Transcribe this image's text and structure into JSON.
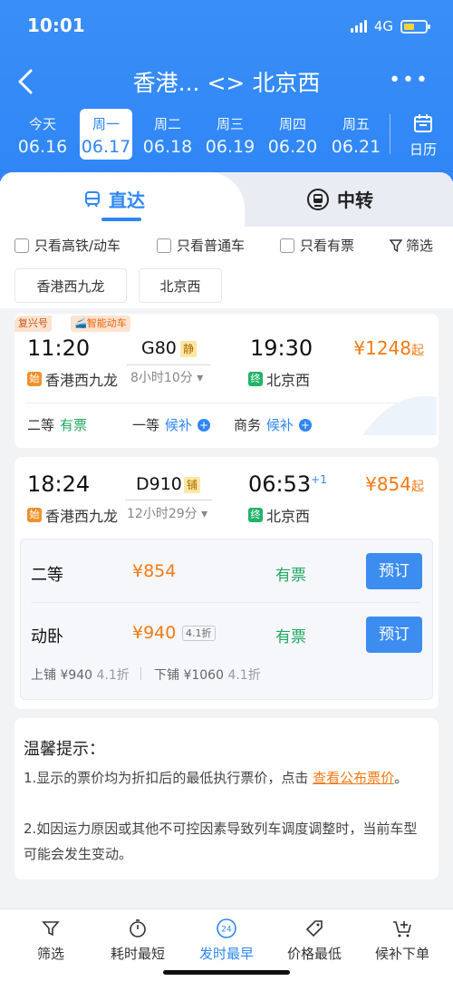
{
  "status_bar": {
    "time": "10:01",
    "network": "4G",
    "battery_level": 0.5
  },
  "header": {
    "route_from": "香港...",
    "route_sep": "<>",
    "route_to": "北京西",
    "more_label": "•••"
  },
  "dates": [
    {
      "dow": "今天",
      "md": "06.16"
    },
    {
      "dow": "周一",
      "md": "06.17",
      "active": true
    },
    {
      "dow": "周二",
      "md": "06.18"
    },
    {
      "dow": "周三",
      "md": "06.19"
    },
    {
      "dow": "周四",
      "md": "06.20"
    },
    {
      "dow": "周五",
      "md": "06.21"
    }
  ],
  "calendar_label": "日历",
  "tabs": {
    "direct": "直达",
    "transfer": "中转"
  },
  "filters": {
    "high_speed": "只看高铁/动车",
    "normal": "只看普通车",
    "available": "只看有票",
    "filter": "筛选"
  },
  "chips": {
    "from": "香港西九龙",
    "to": "北京西"
  },
  "trains": [
    {
      "tags": [
        "复兴号",
        "智能动车"
      ],
      "depart": "11:20",
      "train_no": "G80",
      "badge": "静",
      "duration": "8小时10分",
      "arrive": "19:30",
      "price": "¥1248",
      "price_suffix": "起",
      "from_mark": "始",
      "from_station": "香港西九龙",
      "to_mark": "终",
      "to_station": "北京西",
      "seats": [
        {
          "name": "二等",
          "status": "有票"
        },
        {
          "name": "一等",
          "status": "候补"
        },
        {
          "name": "商务",
          "status": "候补"
        }
      ]
    },
    {
      "depart": "18:24",
      "train_no": "D910",
      "badge": "铺",
      "duration": "12小时29分",
      "arrive": "06:53",
      "arrive_plus": "+1",
      "price": "¥854",
      "price_suffix": "起",
      "from_mark": "始",
      "from_station": "香港西九龙",
      "to_mark": "终",
      "to_station": "北京西",
      "expanded": [
        {
          "name": "二等",
          "price": "¥854",
          "status": "有票",
          "book": "预订"
        },
        {
          "name": "动卧",
          "price": "¥940",
          "discount": "4.1折",
          "status": "有票",
          "book": "预订"
        }
      ],
      "berths": {
        "upper": "上铺 ¥940",
        "upper_disc": "4.1折",
        "lower": "下铺 ¥1060",
        "lower_disc": "4.1折"
      }
    }
  ],
  "notice": {
    "title": "温馨提示：",
    "line1_pre": "1.显示的票价均为折扣后的最低执行票价，点击 ",
    "line1_link": "查看公布票价",
    "line1_post": "。",
    "line2": "2.如因运力原因或其他不可控因素导致列车调度调整时，当前车型可能会发生变动。"
  },
  "bottom_bar": [
    {
      "label": "筛选",
      "icon": "filter-icon"
    },
    {
      "label": "耗时最短",
      "icon": "timer-icon"
    },
    {
      "label": "发时最早",
      "icon": "clock-24-icon",
      "active": true
    },
    {
      "label": "价格最低",
      "icon": "price-tag-icon"
    },
    {
      "label": "候补下单",
      "icon": "cart-add-icon"
    }
  ],
  "colors": {
    "brand": "#2f86f5",
    "price": "#f37a13",
    "available": "#22a860"
  }
}
